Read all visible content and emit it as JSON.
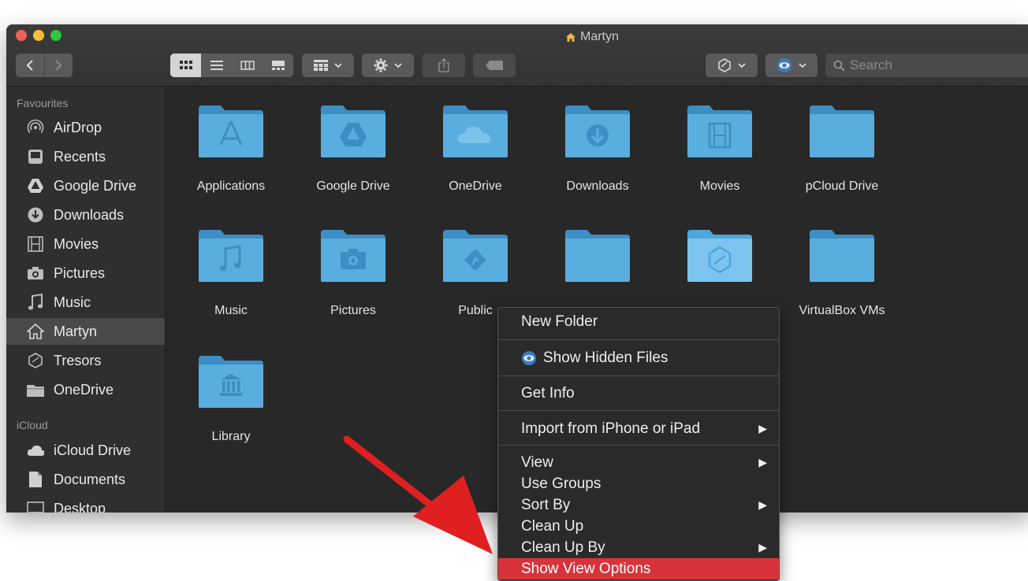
{
  "window": {
    "title": "Martyn"
  },
  "toolbar": {
    "search_placeholder": "Search"
  },
  "sidebar": {
    "favourites_header": "Favourites",
    "favourites": [
      {
        "label": "AirDrop",
        "icon": "airdrop-icon"
      },
      {
        "label": "Recents",
        "icon": "recents-icon"
      },
      {
        "label": "Google Drive",
        "icon": "google-drive-icon"
      },
      {
        "label": "Downloads",
        "icon": "downloads-icon"
      },
      {
        "label": "Movies",
        "icon": "movies-icon"
      },
      {
        "label": "Pictures",
        "icon": "camera-icon"
      },
      {
        "label": "Music",
        "icon": "music-note-icon"
      },
      {
        "label": "Martyn",
        "icon": "home-icon",
        "selected": true
      },
      {
        "label": "Tresors",
        "icon": "tresors-icon"
      },
      {
        "label": "OneDrive",
        "icon": "folder-icon"
      }
    ],
    "icloud_header": "iCloud",
    "icloud": [
      {
        "label": "iCloud Drive",
        "icon": "cloud-icon"
      },
      {
        "label": "Documents",
        "icon": "documents-icon"
      },
      {
        "label": "Desktop",
        "icon": "desktop-icon"
      }
    ]
  },
  "folders": [
    {
      "label": "Applications",
      "icon": "applications-folder-icon"
    },
    {
      "label": "Google Drive",
      "icon": "google-drive-folder-icon"
    },
    {
      "label": "OneDrive",
      "icon": "cloud-folder-icon"
    },
    {
      "label": "Downloads",
      "icon": "downloads-folder-icon"
    },
    {
      "label": "Movies",
      "icon": "movies-folder-icon"
    },
    {
      "label": "pCloud Drive",
      "icon": "folder-icon"
    },
    {
      "label": "Music",
      "icon": "music-folder-icon"
    },
    {
      "label": "Pictures",
      "icon": "pictures-folder-icon"
    },
    {
      "label": "Public",
      "icon": "public-folder-icon"
    },
    {
      "label": "",
      "icon": "folder-icon"
    },
    {
      "label": "",
      "icon": "tresors-folder-icon"
    },
    {
      "label": "VirtualBox VMs",
      "icon": "folder-icon"
    },
    {
      "label": "Library",
      "icon": "library-folder-icon"
    }
  ],
  "context_menu": {
    "new_folder": "New Folder",
    "show_hidden_files": "Show Hidden Files",
    "get_info": "Get Info",
    "import_from_iphone": "Import from iPhone or iPad",
    "view": "View",
    "use_groups": "Use Groups",
    "sort_by": "Sort By",
    "clean_up": "Clean Up",
    "clean_up_by": "Clean Up By",
    "show_view_options": "Show View Options",
    "submenu_arrow": "▶"
  },
  "colors": {
    "window_bg": "#282828",
    "folder_blue": "#5aaedf",
    "highlight": "#d8333b",
    "annotation_arrow": "#e02020"
  }
}
